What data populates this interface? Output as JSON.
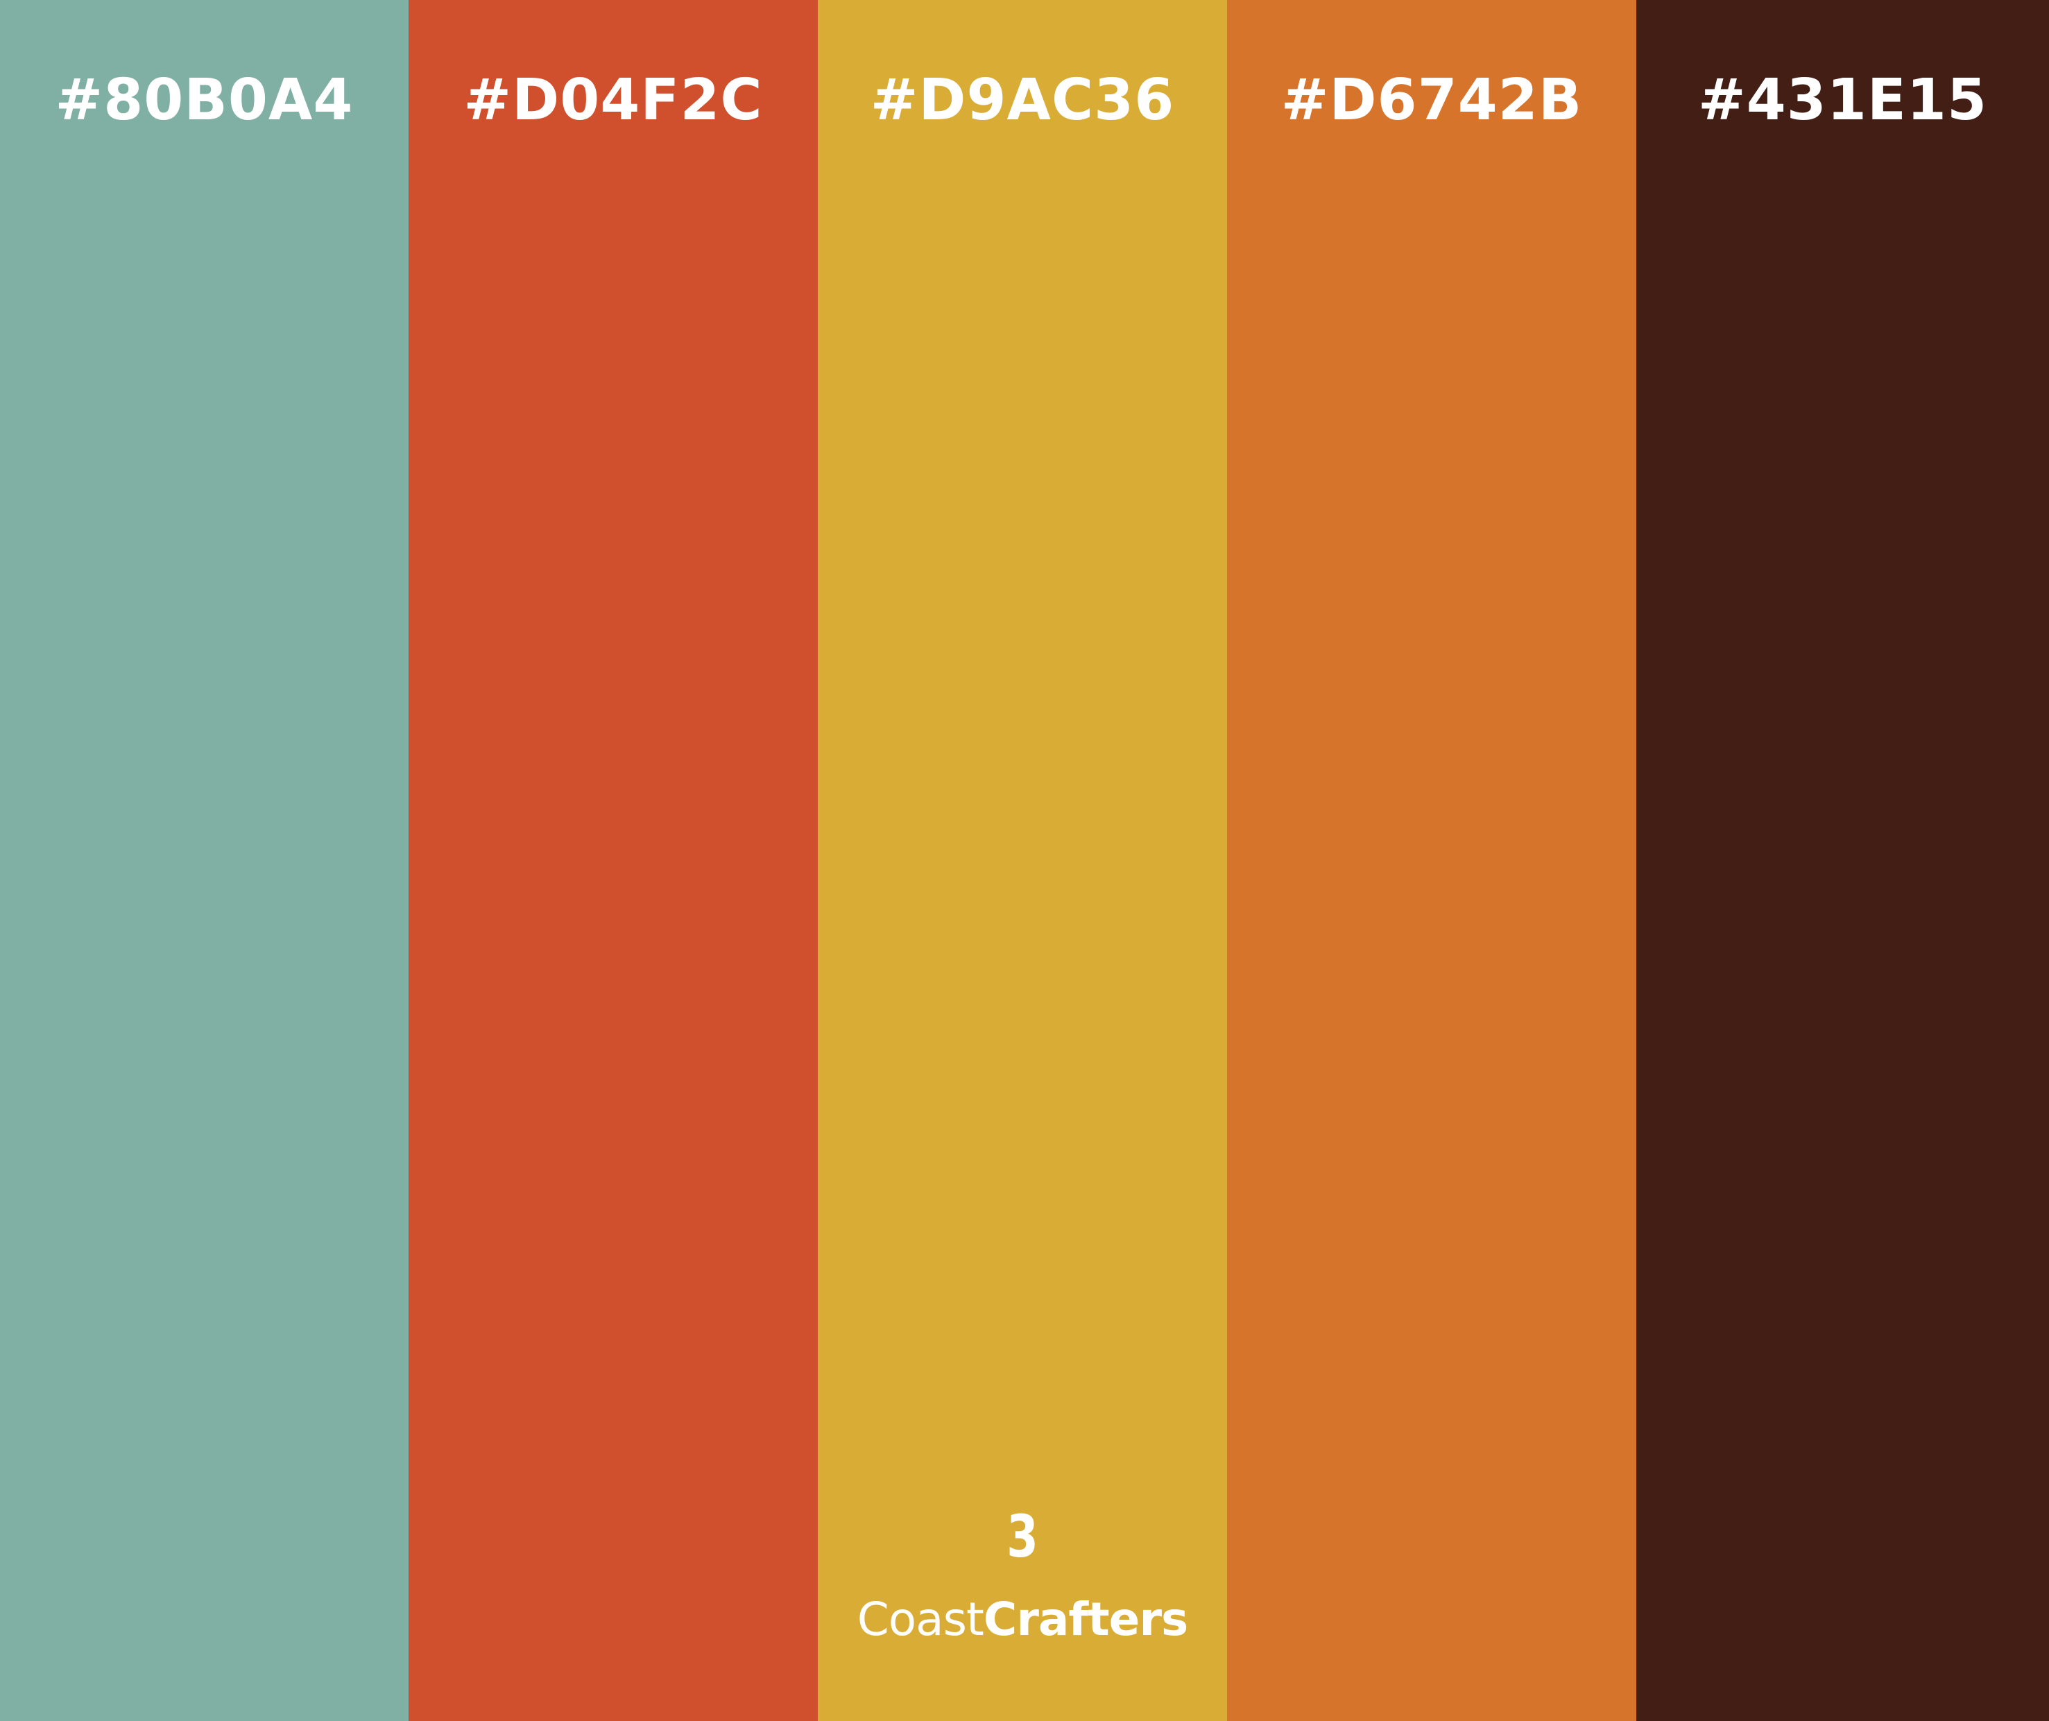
{
  "swatches": [
    {
      "hex_label": "#80B0A4",
      "color": "#80B0A4"
    },
    {
      "hex_label": "#D04F2C",
      "color": "#D04F2C"
    },
    {
      "hex_label": "#D9AC36",
      "color": "#D9AC36"
    },
    {
      "hex_label": "#D6742B",
      "color": "#D6742B"
    },
    {
      "hex_label": "#431E15",
      "color": "#431E15"
    }
  ],
  "brand": {
    "mark": "3",
    "name_light": "Coast",
    "name_bold": "Crafters"
  }
}
